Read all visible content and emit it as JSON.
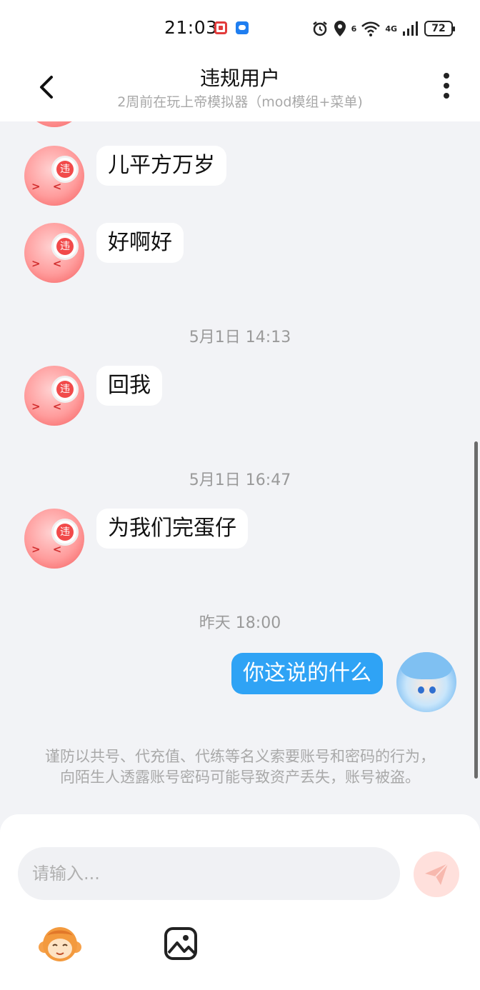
{
  "status_bar": {
    "time": "21:03",
    "network_label": "4G",
    "wifi_label": "6",
    "battery": "72"
  },
  "header": {
    "title": "违规用户",
    "subtitle": "2周前在玩上帝模拟器（mod模组+菜单)"
  },
  "avatar_badge": "违",
  "avatar_face": "> <",
  "messages": [
    {
      "side": "left",
      "text": "儿平方万岁"
    },
    {
      "side": "left",
      "text": "好啊好"
    },
    {
      "type": "time",
      "text": "5月1日 14:13"
    },
    {
      "side": "left",
      "text": "回我"
    },
    {
      "type": "time",
      "text": "5月1日 16:47"
    },
    {
      "side": "left",
      "text": "为我们完蛋仔"
    },
    {
      "type": "time",
      "text": "昨天 18:00"
    },
    {
      "side": "right",
      "text": "你这说的什么"
    }
  ],
  "notice": "谨防以共号、代充值、代练等名义索要账号和密码的行为，向陌生人透露账号密码可能导致资产丢失，账号被盗。",
  "input": {
    "placeholder": "请输入...",
    "value": ""
  },
  "colors": {
    "accent_blue": "#2fa3f5",
    "send_button": "#ffe0dc",
    "brand_red": "#f14a4a"
  },
  "icons": {
    "back": "chevron-left-icon",
    "more": "more-vertical-icon",
    "send": "send-icon",
    "emoji": "monkey-emoji-icon",
    "image": "image-icon"
  }
}
